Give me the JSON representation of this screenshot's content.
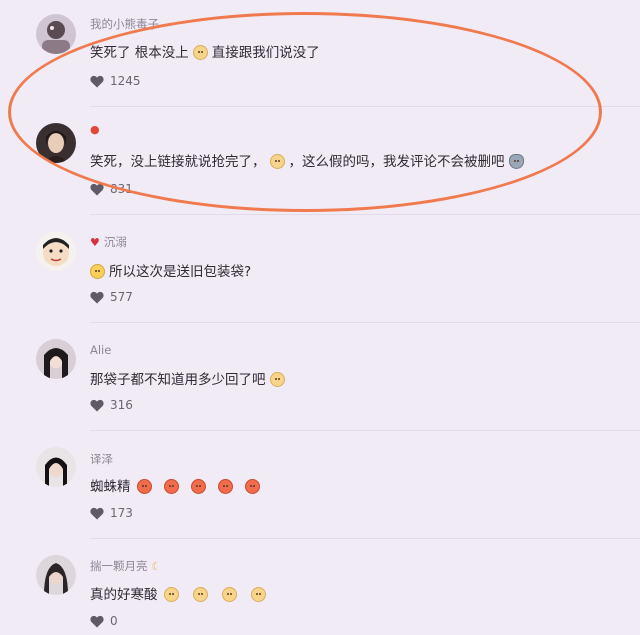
{
  "comments": [
    {
      "username": "我的小熊毒子",
      "text_parts": [
        "笑死了 根本没上",
        "直接跟我们说没了"
      ],
      "likes": "1245"
    },
    {
      "username": "",
      "name_icon": "balloon-icon",
      "text_parts": [
        "笑死，没上链接就说抢完了，",
        "，这么假的吗，我发评论不会被删吧"
      ],
      "likes": "831"
    },
    {
      "username": "沉溺",
      "name_icon": "strawberry-icon",
      "text_parts": [
        "所以这次是送旧包装袋?"
      ],
      "likes": "577"
    },
    {
      "username": "Alie",
      "text_parts": [
        "那袋子都不知道用多少回了吧"
      ],
      "likes": "316"
    },
    {
      "username": "译泽",
      "text_parts": [
        "蜘蛛精"
      ],
      "likes": "173"
    },
    {
      "username": "揣一颗月亮",
      "name_icon": "crescent-moon-icon",
      "text_parts": [
        "真的好寒酸"
      ],
      "likes": "0"
    }
  ],
  "colors": {
    "background": "#f1ebf6",
    "highlight_oval": "#f07a4e",
    "username": "#8d8596"
  }
}
